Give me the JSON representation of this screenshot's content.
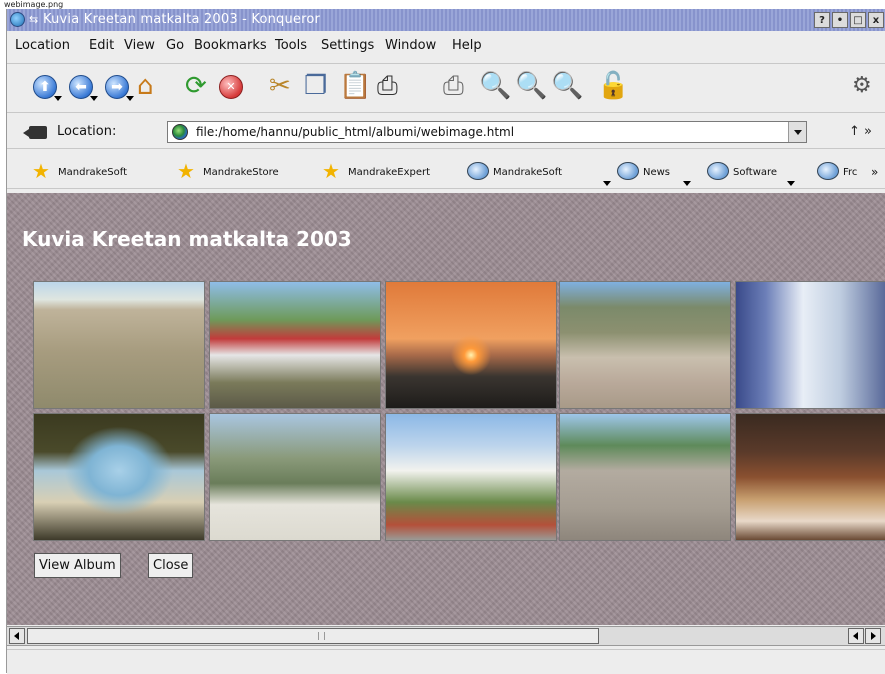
{
  "caption": "webimage.png",
  "window": {
    "title": "Kuvia Kreetan matkalta 2003 - Konqueror",
    "buttons": [
      "?",
      "•",
      "□",
      "x"
    ]
  },
  "menu": [
    "Location",
    "Edit",
    "View",
    "Go",
    "Bookmarks",
    "Tools",
    "Settings",
    "Window",
    "Help"
  ],
  "location": {
    "label": "Location:",
    "url": "file:/home/hannu/public_html/albumi/webimage.html",
    "more": "↑ »"
  },
  "bookmarks": {
    "items": [
      "MandrakeSoft",
      "MandrakeStore",
      "MandrakeExpert",
      "MandrakeSoft",
      "News",
      "Software",
      "Frc"
    ],
    "more": "»"
  },
  "page": {
    "heading": "Kuvia Kreetan matkalta 2003",
    "thumbnails": [
      "dune-grass",
      "tourist-train",
      "sunset",
      "village-aerial",
      "blue-white-interior",
      "tree-beach",
      "hills-wall",
      "white-villas",
      "rocky-shore",
      "night-restaurant"
    ],
    "buttons": {
      "view": "View Album",
      "close": "Close"
    }
  },
  "colors": {
    "titlebar": "#8f9bd2",
    "content_bg": "#9c8c93"
  }
}
